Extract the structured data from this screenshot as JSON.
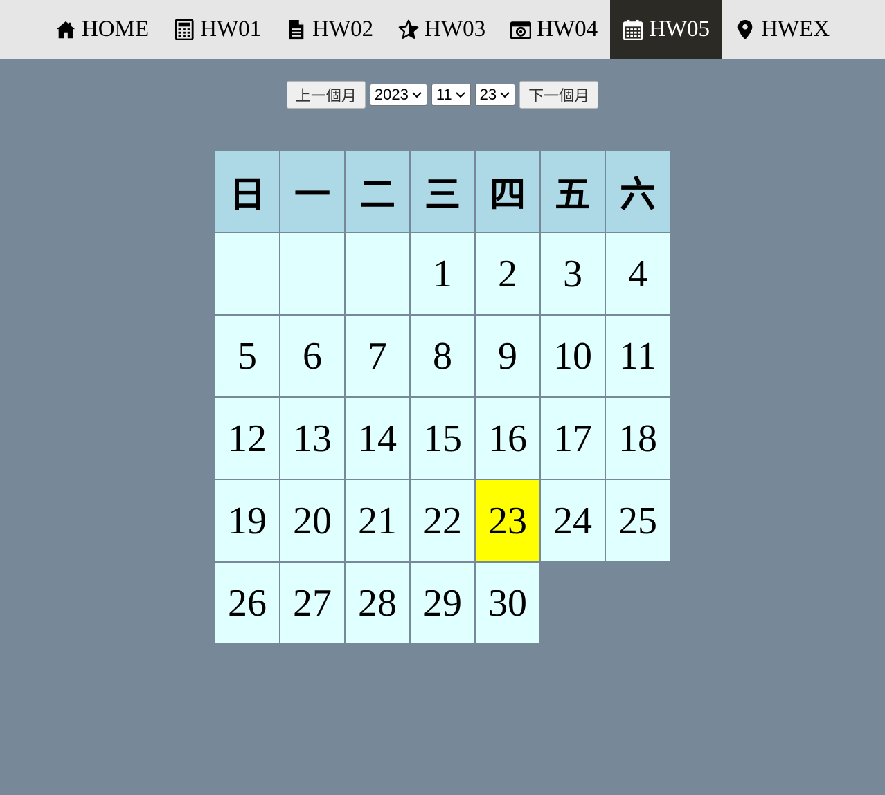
{
  "nav": {
    "items": [
      {
        "label": "HOME",
        "icon": "home-icon"
      },
      {
        "label": "HW01",
        "icon": "calculator-icon"
      },
      {
        "label": "HW02",
        "icon": "document-icon"
      },
      {
        "label": "HW03",
        "icon": "star-icon"
      },
      {
        "label": "HW04",
        "icon": "camera-icon"
      },
      {
        "label": "HW05",
        "icon": "calendar-icon",
        "active": true
      },
      {
        "label": "HWEX",
        "icon": "map-pin-icon"
      }
    ]
  },
  "controls": {
    "prev_label": "上一個月",
    "next_label": "下一個月",
    "year_value": "2023",
    "month_value": "11",
    "day_value": "23"
  },
  "calendar": {
    "weekdays": [
      "日",
      "一",
      "二",
      "三",
      "四",
      "五",
      "六"
    ],
    "weeks": [
      [
        "",
        "",
        "",
        "1",
        "2",
        "3",
        "4"
      ],
      [
        "5",
        "6",
        "7",
        "8",
        "9",
        "10",
        "11"
      ],
      [
        "12",
        "13",
        "14",
        "15",
        "16",
        "17",
        "18"
      ],
      [
        "19",
        "20",
        "21",
        "22",
        "23",
        "24",
        "25"
      ],
      [
        "26",
        "27",
        "28",
        "29",
        "30",
        "",
        ""
      ]
    ],
    "selected_day": "23"
  },
  "colors": {
    "page_background": "#778899",
    "nav_background": "#e6e6e6",
    "nav_active_background": "#2b2a25",
    "header_cell": "#add8e6",
    "day_cell": "#e0ffff",
    "selected_day": "#ffff00"
  }
}
